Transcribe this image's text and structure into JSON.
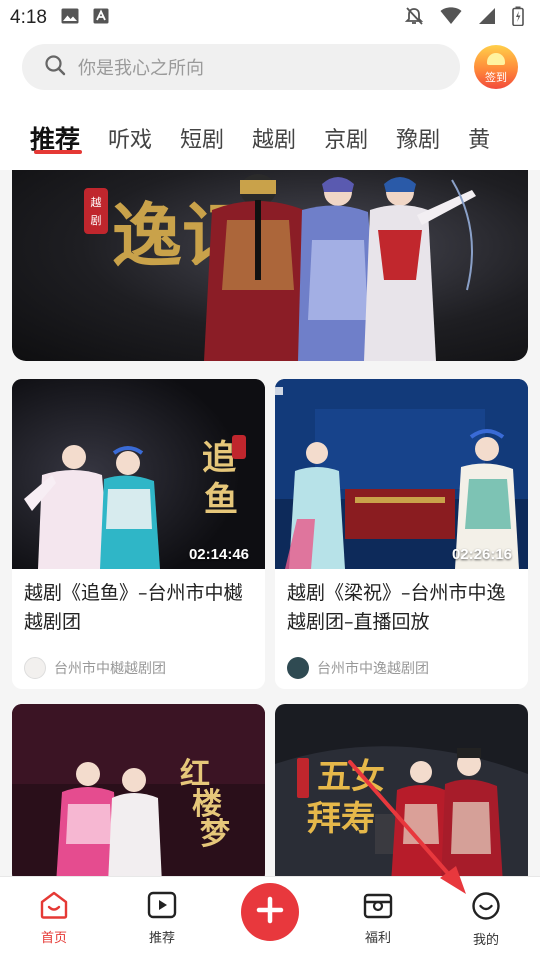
{
  "status_bar": {
    "time": "4:18"
  },
  "search": {
    "placeholder": "你是我心之所向"
  },
  "signin": {
    "label": "签到"
  },
  "tabs": [
    {
      "label": "推荐",
      "active": true
    },
    {
      "label": "听戏"
    },
    {
      "label": "短剧"
    },
    {
      "label": "越剧"
    },
    {
      "label": "京剧"
    },
    {
      "label": "豫剧"
    },
    {
      "label": "黄"
    }
  ],
  "banner": {
    "title_art": "逸记",
    "badge": "越剧"
  },
  "cards": [
    {
      "title": "越剧《追鱼》–台州市中樾越剧团",
      "duration": "02:14:46",
      "author": "台州市中樾越剧团",
      "thumb_text": "追鱼",
      "thumb_badge": "越剧"
    },
    {
      "title": "越剧《梁祝》–台州市中逸越剧团–直播回放",
      "duration": "02:26:16",
      "author": "台州市中逸越剧团"
    },
    {
      "title": "",
      "duration": "",
      "author": "",
      "thumb_text": "红楼梦"
    },
    {
      "title": "",
      "duration": "",
      "author": "",
      "thumb_text": "五女拜寿"
    }
  ],
  "bottom_nav": [
    {
      "label": "首页",
      "icon": "home-icon",
      "active": true
    },
    {
      "label": "推荐",
      "icon": "play-icon"
    },
    {
      "label": "",
      "icon": "plus-icon"
    },
    {
      "label": "福利",
      "icon": "gift-icon"
    },
    {
      "label": "我的",
      "icon": "profile-icon"
    }
  ],
  "colors": {
    "accent": "#e53935",
    "plus_button": "#e8383d"
  }
}
